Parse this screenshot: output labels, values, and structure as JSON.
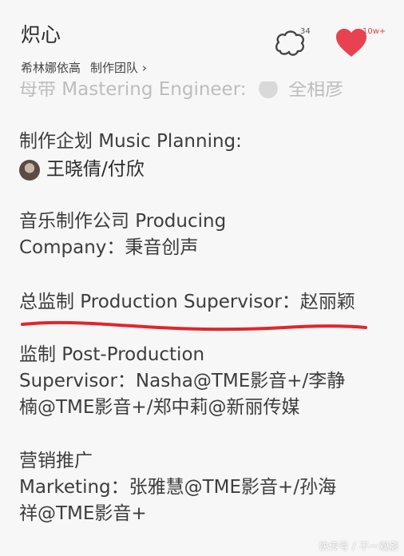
{
  "header": {
    "title": "炽心",
    "artist": "希林娜依高",
    "team_link": "制作团队",
    "comments_count": "34",
    "likes_count": "10w+"
  },
  "credits": {
    "partial_top": {
      "role": "母带 Mastering Engineer:",
      "name": "全相彦"
    },
    "music_planning": {
      "role": "制作企划 Music Planning:",
      "name": "王晓倩/付欣"
    },
    "producing_company": {
      "line1": "音乐制作公司 Producing",
      "line2": "Company：秉音创声"
    },
    "production_supervisor": {
      "text": "总监制 Production Supervisor：赵丽颖"
    },
    "post_production": {
      "line1": "监制 Post-Production",
      "line2": "Supervisor：Nasha@TME影音+/李静",
      "line3": "楠@TME影音+/郑中莉@新丽传媒"
    },
    "marketing": {
      "line1": "营销推广",
      "line2": "Marketing：张雅慧@TME影音+/孙海",
      "line3": "祥@TME影音+"
    }
  },
  "watermark": "快传号 / 不一观影",
  "colors": {
    "annotation_red": "#e0262e",
    "like_red": "#e8414f"
  }
}
